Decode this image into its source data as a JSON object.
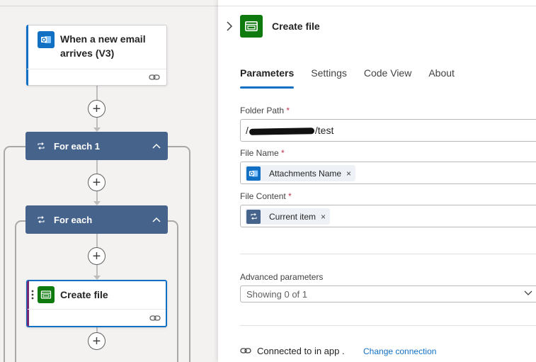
{
  "canvas": {
    "trigger": {
      "title_line1": "When a new email",
      "title_line2": "arrives (V3)",
      "icon": "outlook-icon"
    },
    "loop_outer": {
      "title": "For each 1",
      "icon": "loop-icon"
    },
    "loop_inner": {
      "title": "For each",
      "icon": "loop-icon"
    },
    "action": {
      "title": "Create file",
      "icon": "sharepoint-icon"
    }
  },
  "panel": {
    "title": "Create file",
    "icon": "sharepoint-icon",
    "tabs": [
      {
        "label": "Parameters",
        "active": true
      },
      {
        "label": "Settings",
        "active": false
      },
      {
        "label": "Code View",
        "active": false
      },
      {
        "label": "About",
        "active": false
      }
    ],
    "fields": {
      "folder_path": {
        "label": "Folder Path",
        "required": "*",
        "value_prefix": "/",
        "value_suffix": "/test"
      },
      "file_name": {
        "label": "File Name",
        "required": "*",
        "token": "Attachments Name",
        "token_remove": "×"
      },
      "file_content": {
        "label": "File Content",
        "required": "*",
        "token": "Current item",
        "token_remove": "×"
      }
    },
    "advanced": {
      "label": "Advanced parameters",
      "value": "Showing 0 of 1"
    },
    "connection": {
      "text": "Connected to in app .",
      "link": "Change connection"
    }
  },
  "colors": {
    "accent_blue": "#1170c4",
    "loop_bar": "#46638c",
    "sharepoint_green": "#0f7b0f",
    "required_red": "#c4314b"
  }
}
